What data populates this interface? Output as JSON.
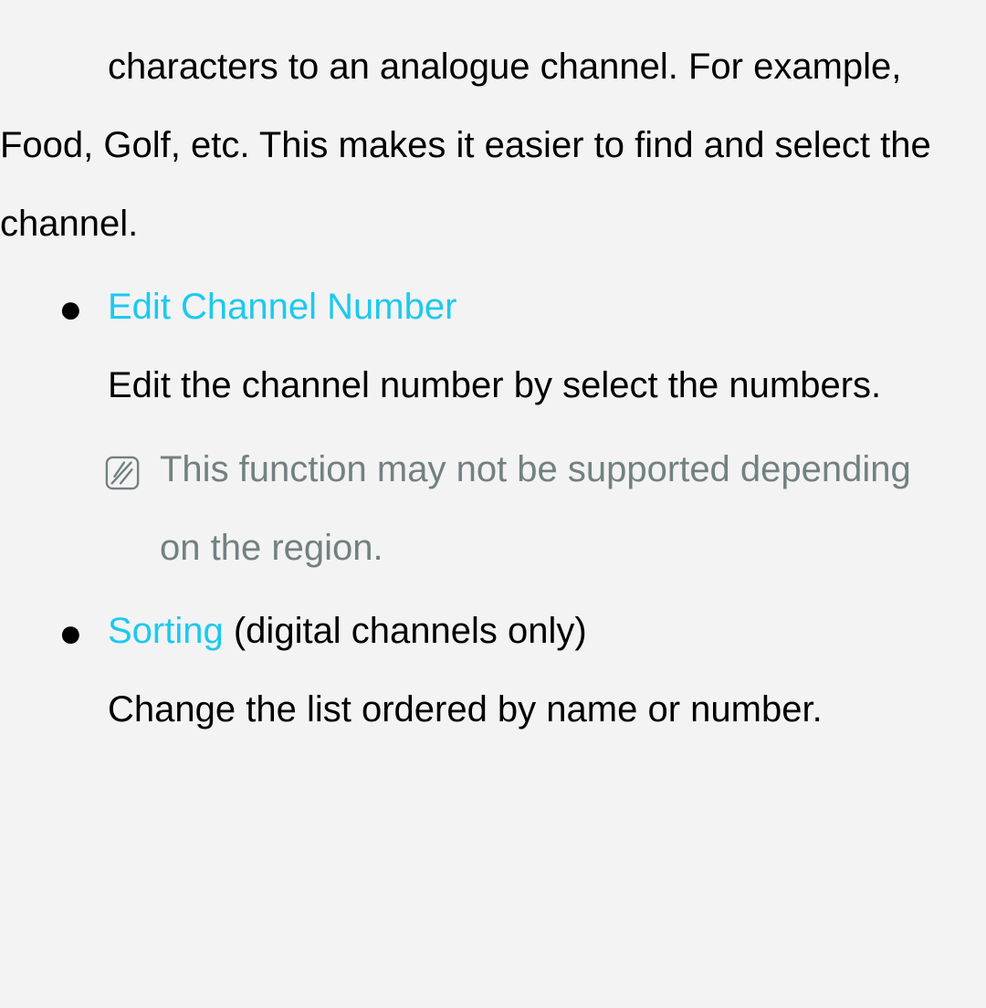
{
  "intro": "characters to an analogue channel. For example, Food, Golf, etc. This makes it easier to find and select the channel.",
  "items": [
    {
      "title": "Edit Channel Number",
      "suffix": "",
      "body": "Edit the channel number by select the numbers.",
      "note": "This function may not be supported depending on the region."
    },
    {
      "title": "Sorting",
      "suffix": " (digital channels only)",
      "body": "Change the list ordered by name or number.",
      "note": ""
    }
  ]
}
